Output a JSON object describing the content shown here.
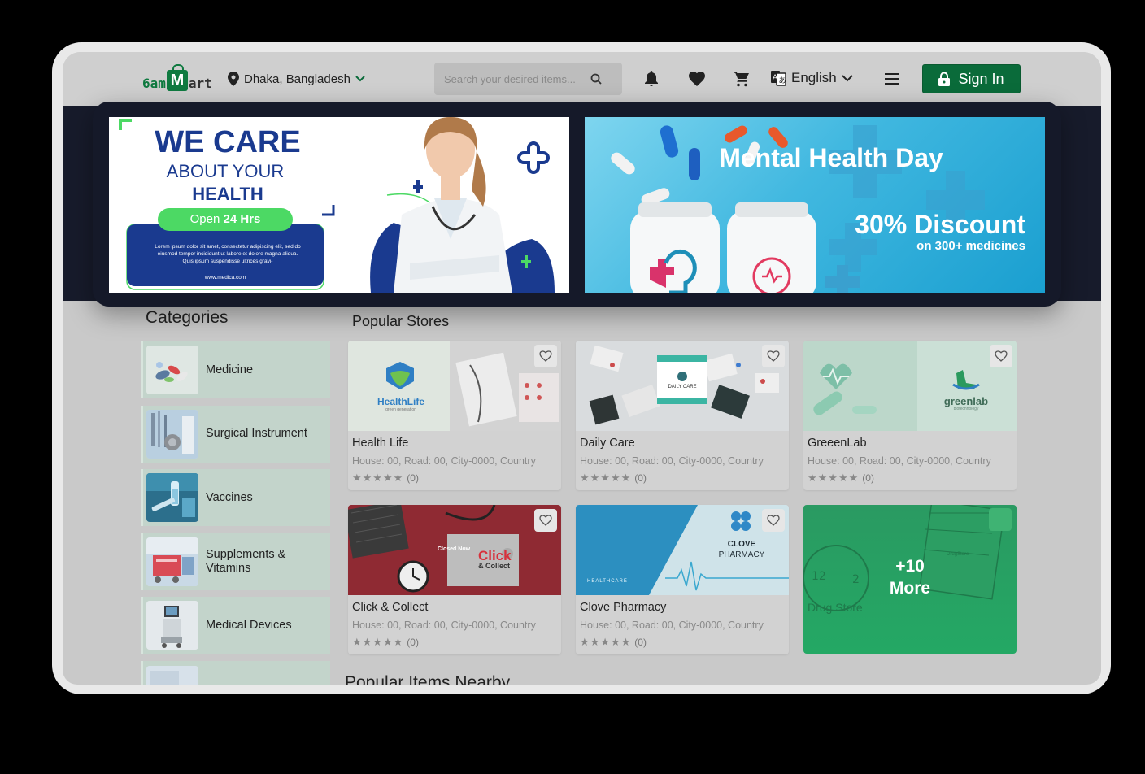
{
  "header": {
    "logo_part1": "6am",
    "logo_bag": "M",
    "logo_part2": "art",
    "location": "Dhaka, Bangladesh",
    "search_placeholder": "Search your desired items...",
    "language": "English",
    "signin_label": "Sign In"
  },
  "banners": [
    {
      "headline1": "WE CARE",
      "headline2": "ABOUT YOUR",
      "headline3": "HEALTH",
      "pill_prefix": "Open ",
      "pill_strong": "24 Hrs",
      "body": "Lorem ipsum dolor sit amet, consectetur adipiscing elit, sed do eiusmod tempor incididunt ut labore et dolore magna aliqua. Quis ipsum suspendisse ultrices gravi-",
      "website": "www.medica.com"
    },
    {
      "title": "Mental Health Day",
      "discount": "30% Discount",
      "subtitle": "on 300+ medicines"
    }
  ],
  "categories": {
    "title": "Categories",
    "items": [
      {
        "label": "Medicine"
      },
      {
        "label": "Surgical Instrument"
      },
      {
        "label": "Vaccines"
      },
      {
        "label": "Supplements & Vitamins"
      },
      {
        "label": "Medical Devices"
      }
    ]
  },
  "stores": {
    "title": "Popular Stores",
    "items": [
      {
        "name": "Health Life",
        "address": "House: 00, Road: 00, City-0000, Country",
        "stars": "★★★★★",
        "count": "(0)",
        "brand": "HealthLife",
        "brand_sub": "green generation"
      },
      {
        "name": "Daily Care",
        "address": "House: 00, Road: 00, City-0000, Country",
        "stars": "★★★★★",
        "count": "(0)",
        "brand": "DAILY CARE"
      },
      {
        "name": "GreeenLab",
        "address": "House: 00, Road: 00, City-0000, Country",
        "stars": "★★★★★",
        "count": "(0)",
        "brand": "greenlab",
        "brand_sub": "biotechnology"
      },
      {
        "name": "Click & Collect",
        "address": "House: 00, Road: 00, City-0000, Country",
        "stars": "★★★★★",
        "count": "(0)",
        "brand": "Click",
        "brand_sub": "& Collect",
        "tag": "Closed Now"
      },
      {
        "name": "Clove Pharmacy",
        "address": "House: 00, Road: 00, City-0000, Country",
        "stars": "★★★★★",
        "count": "(0)",
        "brand": "CLOVE",
        "brand_sub": "PHARMACY",
        "tag": "HEALTHCARE"
      }
    ],
    "more_line1": "+10",
    "more_line2": "More",
    "more_bg_label": "Drug Store",
    "more_bg_brand": "DrugStore"
  },
  "nearby": {
    "title": "Popular Items Nearby"
  },
  "colors": {
    "brand_green": "#0a6b3a",
    "banner_navy": "#151929",
    "banner_headline": "#1a3a8f",
    "pill_green": "#4cd964"
  }
}
